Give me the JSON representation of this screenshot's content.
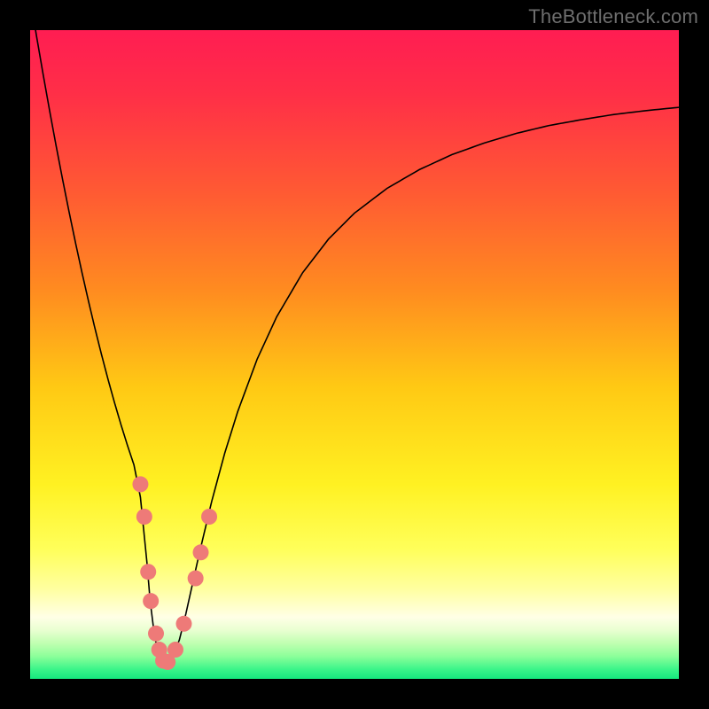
{
  "attribution": "TheBottleneck.com",
  "chart_data": {
    "type": "line",
    "title": "",
    "xlabel": "",
    "ylabel": "",
    "xlim": [
      0,
      100
    ],
    "ylim": [
      0,
      100
    ],
    "background_gradient": {
      "stops": [
        {
          "offset": 0.0,
          "color": "#ff1d52"
        },
        {
          "offset": 0.1,
          "color": "#ff2f47"
        },
        {
          "offset": 0.25,
          "color": "#ff5a33"
        },
        {
          "offset": 0.4,
          "color": "#ff8b20"
        },
        {
          "offset": 0.55,
          "color": "#ffc914"
        },
        {
          "offset": 0.7,
          "color": "#fff122"
        },
        {
          "offset": 0.8,
          "color": "#ffff5a"
        },
        {
          "offset": 0.86,
          "color": "#ffff9e"
        },
        {
          "offset": 0.905,
          "color": "#ffffe6"
        },
        {
          "offset": 0.925,
          "color": "#e9ffd1"
        },
        {
          "offset": 0.945,
          "color": "#c0ffb1"
        },
        {
          "offset": 0.965,
          "color": "#8dff9a"
        },
        {
          "offset": 0.985,
          "color": "#3cf58a"
        },
        {
          "offset": 1.0,
          "color": "#15e87e"
        }
      ]
    },
    "series": [
      {
        "name": "curve",
        "stroke": "#000000",
        "stroke_width": 1.6,
        "x": [
          0,
          1,
          2,
          3,
          4,
          5,
          6,
          7,
          8,
          9,
          10,
          11,
          12,
          13,
          14,
          15,
          16,
          17,
          18,
          18.5,
          19,
          19.5,
          20,
          20.5,
          21,
          21.5,
          22,
          23,
          24,
          25,
          26,
          28,
          30,
          32,
          35,
          38,
          42,
          46,
          50,
          55,
          60,
          65,
          70,
          75,
          80,
          85,
          90,
          95,
          100
        ],
        "y": [
          105,
          99.0,
          93.2,
          87.6,
          82.2,
          77.0,
          72.0,
          67.2,
          62.6,
          58.2,
          54.0,
          50.0,
          46.2,
          42.6,
          39.2,
          36.0,
          33.0,
          28.0,
          18.0,
          12.0,
          8.0,
          5.0,
          3.5,
          2.8,
          2.5,
          2.8,
          3.5,
          6.0,
          10.0,
          14.5,
          19.0,
          27.4,
          34.8,
          41.2,
          49.3,
          55.8,
          62.6,
          67.8,
          71.8,
          75.6,
          78.5,
          80.8,
          82.6,
          84.1,
          85.3,
          86.2,
          87.0,
          87.6,
          88.1
        ]
      }
    ],
    "marker_style": {
      "color": "#ee7a78",
      "radius": 9
    },
    "markers_xy": [
      [
        17.0,
        30.0
      ],
      [
        17.6,
        25.0
      ],
      [
        18.2,
        16.5
      ],
      [
        18.6,
        12.0
      ],
      [
        19.4,
        7.0
      ],
      [
        19.9,
        4.5
      ],
      [
        20.5,
        2.8
      ],
      [
        21.2,
        2.6
      ],
      [
        22.4,
        4.5
      ],
      [
        23.7,
        8.5
      ],
      [
        25.5,
        15.5
      ],
      [
        26.3,
        19.5
      ],
      [
        27.6,
        25.0
      ]
    ]
  }
}
